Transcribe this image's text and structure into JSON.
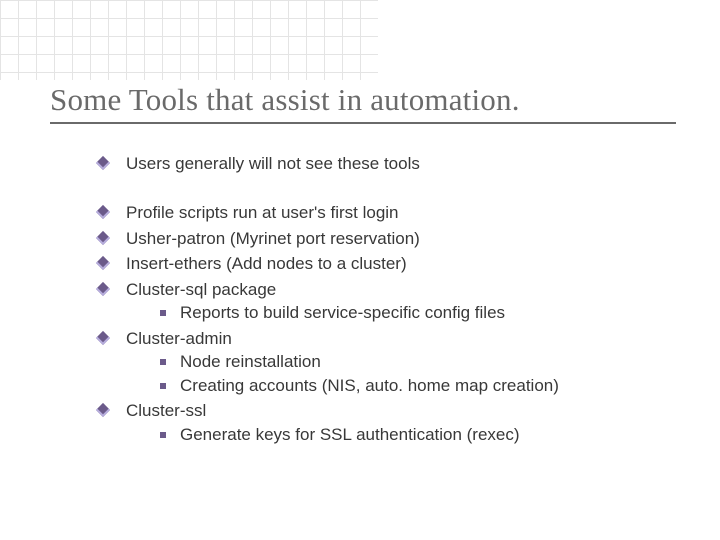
{
  "title": "Some Tools that assist in automation.",
  "intro": "Users generally will not see these tools",
  "items": [
    {
      "text": "Profile scripts run at user's first login"
    },
    {
      "text": "Usher-patron (Myrinet port reservation)"
    },
    {
      "text": "Insert-ethers (Add nodes to a cluster)"
    },
    {
      "text": "Cluster-sql package",
      "sub": [
        "Reports to build service-specific config files"
      ]
    },
    {
      "text": "Cluster-admin",
      "sub": [
        "Node reinstallation",
        "Creating accounts (NIS, auto. home map creation)"
      ]
    },
    {
      "text": "Cluster-ssl",
      "sub": [
        "Generate keys for SSL authentication (rexec)"
      ]
    }
  ]
}
